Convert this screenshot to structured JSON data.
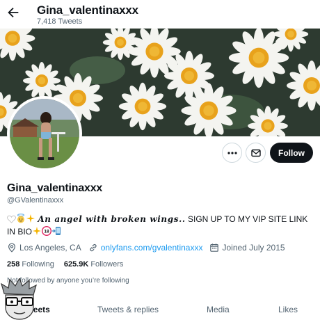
{
  "header": {
    "display_name": "Gina_valentinaxxx",
    "tweet_count": "7,418 Tweets"
  },
  "profile": {
    "display_name": "Gina_valentinaxxx",
    "handle": "@GValentinaxxx",
    "bio_script": "An angel with broken wings..",
    "bio_text": " SIGN UP TO MY VIP SITE LINK IN BIO",
    "bio_badge": "18",
    "location": "Los Angeles, CA",
    "website": "onlyfans.com/gvalentinaxxx",
    "joined": "Joined July 2015",
    "following_count": "258",
    "following_label": "Following",
    "followers_count": "625.9K",
    "followers_label": "Followers",
    "followed_by": "Not followed by anyone you’re following"
  },
  "actions": {
    "follow_label": "Follow"
  },
  "tabs": [
    {
      "label": "Tweets"
    },
    {
      "label": "Tweets & replies"
    },
    {
      "label": "Media"
    },
    {
      "label": "Likes"
    }
  ],
  "colors": {
    "accent": "#1d9bf0",
    "text": "#0f1419",
    "muted": "#536471",
    "border": "#cfd9de",
    "button_dark": "#0f1419",
    "badge_red": "#e0245e"
  },
  "icons": {
    "back": "arrow-left-icon",
    "more": "ellipsis-icon",
    "message": "envelope-icon",
    "location": "location-pin-icon",
    "link": "link-icon",
    "calendar": "calendar-icon"
  }
}
